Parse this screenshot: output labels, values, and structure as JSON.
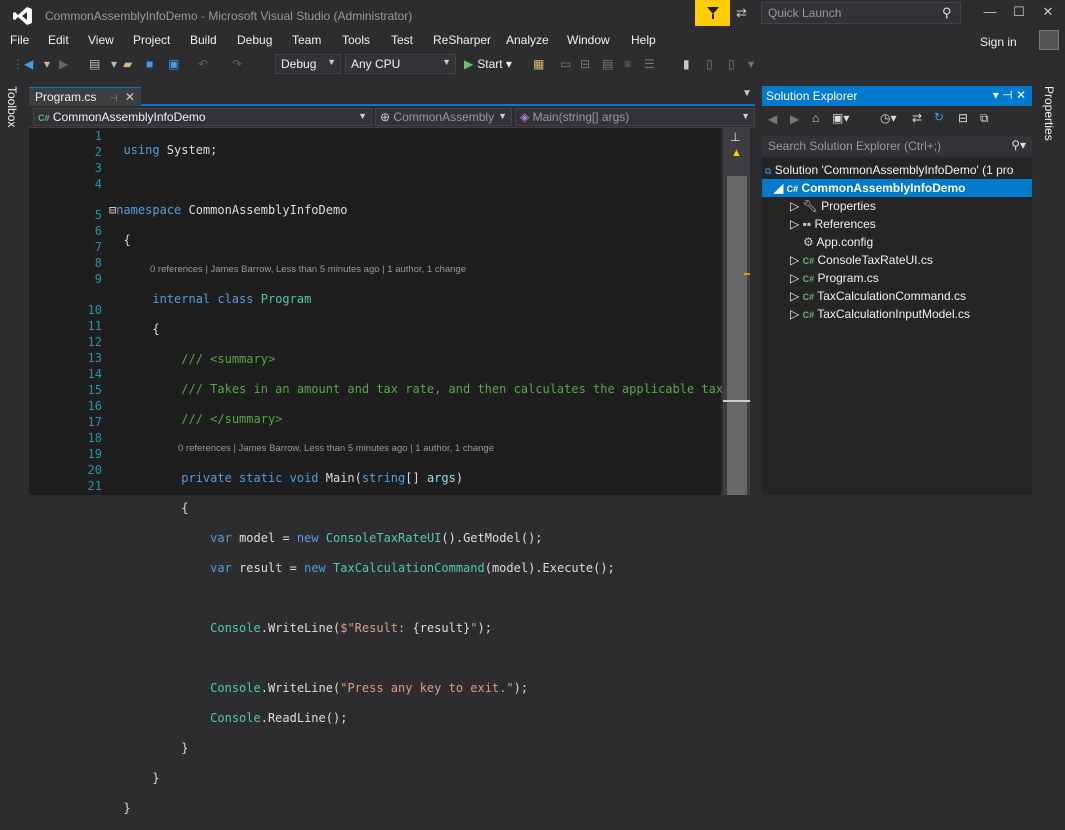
{
  "window": {
    "title": "CommonAssemblyInfoDemo - Microsoft Visual Studio  (Administrator)"
  },
  "quick_launch": {
    "placeholder": "Quick Launch"
  },
  "menu": [
    "File",
    "Edit",
    "View",
    "Project",
    "Build",
    "Debug",
    "Team",
    "Tools",
    "Test",
    "ReSharper",
    "Analyze",
    "Window",
    "Help"
  ],
  "account": {
    "sign_in": "Sign in"
  },
  "toolbar": {
    "config": "Debug",
    "platform": "Any CPU",
    "start": "Start"
  },
  "side": {
    "toolbox": "Toolbox",
    "properties": "Properties"
  },
  "editor": {
    "tab": "Program.cs",
    "nav_project": "CommonAssemblyInfoDemo",
    "nav_class": "CommonAssembly",
    "nav_member": "Main(string[] args)",
    "line_numbers": [
      "1",
      "2",
      "3",
      "4",
      "",
      "5",
      "6",
      "7",
      "8",
      "9",
      "",
      "10",
      "11",
      "12",
      "13",
      "14",
      "15",
      "16",
      "17",
      "18",
      "19",
      "20",
      "21"
    ],
    "lens1": "0 references | James Barrow, Less than 5 minutes ago | 1 author, 1 change",
    "lens2": "0 references | James Barrow, Less than 5 minutes ago | 1 author, 1 change"
  },
  "solution_explorer": {
    "title": "Solution Explorer",
    "search": "Search Solution Explorer (Ctrl+;)",
    "solution": "Solution 'CommonAssemblyInfoDemo' (1 pro",
    "project": "CommonAssemblyInfoDemo",
    "items": [
      "Properties",
      "References",
      "App.config",
      "ConsoleTaxRateUI.cs",
      "Program.cs",
      "TaxCalculationCommand.cs",
      "TaxCalculationInputModel.cs"
    ]
  }
}
